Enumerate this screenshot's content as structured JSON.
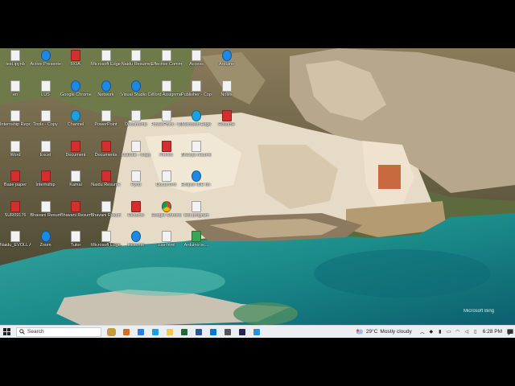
{
  "desktop": {
    "icons": [
      {
        "label": "test.ipynb",
        "glyph": "doc"
      },
      {
        "label": "en",
        "glyph": "doc"
      },
      {
        "label": "Internship Report",
        "glyph": "doc"
      },
      {
        "label": "Word",
        "glyph": "doc"
      },
      {
        "label": "Base paper",
        "glyph": "pdf"
      },
      {
        "label": "SUR09176",
        "glyph": "pdf"
      },
      {
        "label": "Naidu_EVOLL Assignment",
        "glyph": "doc"
      },
      {
        "label": "Active Presenter",
        "glyph": "app"
      },
      {
        "label": "LUS",
        "glyph": "doc"
      },
      {
        "label": "Tools - Copy",
        "glyph": "doc"
      },
      {
        "label": "Excel",
        "glyph": "doc"
      },
      {
        "label": "Internship",
        "glyph": "pdf"
      },
      {
        "label": "Bhavani Resume",
        "glyph": "doc"
      },
      {
        "label": "Zoom",
        "glyph": "app"
      },
      {
        "label": "ROA",
        "glyph": "pdf"
      },
      {
        "label": "Google Chrome",
        "glyph": "app"
      },
      {
        "label": "Channel",
        "glyph": "edge"
      },
      {
        "label": "Document",
        "glyph": "pdf"
      },
      {
        "label": "Kamal",
        "glyph": "doc"
      },
      {
        "label": "Bhavani Resume",
        "glyph": "pdf"
      },
      {
        "label": "Tutor",
        "glyph": "doc"
      },
      {
        "label": "Microsoft Edge",
        "glyph": "doc"
      },
      {
        "label": "Network",
        "glyph": "app"
      },
      {
        "label": "PowerPoint",
        "glyph": "doc"
      },
      {
        "label": "Documents",
        "glyph": "pdf"
      },
      {
        "label": "Naidu Resume",
        "glyph": "pdf"
      },
      {
        "label": "Bhavani Resume",
        "glyph": "doc"
      },
      {
        "label": "Microsoft Edge",
        "glyph": "doc"
      },
      {
        "label": "Naidu Resume",
        "glyph": "doc"
      },
      {
        "label": "Visual Studio Code",
        "glyph": "app"
      },
      {
        "label": "Documents",
        "glyph": "doc"
      },
      {
        "label": "Outlook - Copy",
        "glyph": "doc"
      },
      {
        "label": "Fynd",
        "glyph": "doc"
      },
      {
        "label": "Resume",
        "glyph": "pdf"
      },
      {
        "label": "Resume",
        "glyph": "app"
      },
      {
        "label": "Effective Communication",
        "glyph": "doc"
      },
      {
        "label": "Word Assignment",
        "glyph": "doc"
      },
      {
        "label": "PowerPoint - Copy",
        "glyph": "doc"
      },
      {
        "label": "Firefox",
        "glyph": "pdf"
      },
      {
        "label": "Document",
        "glyph": "doc"
      },
      {
        "label": "Google Chrome",
        "glyph": "chrome"
      },
      {
        "label": ".css-html",
        "glyph": "doc"
      },
      {
        "label": "Access",
        "glyph": "doc"
      },
      {
        "label": "Publisher - Copy",
        "glyph": "doc"
      },
      {
        "label": "Microsoft Edge",
        "glyph": "edge"
      },
      {
        "label": "Bhavya resume",
        "glyph": "doc"
      },
      {
        "label": "Eclipse IDE for Java De...",
        "glyph": "app"
      },
      {
        "label": "test program",
        "glyph": "doc"
      },
      {
        "label": "Arduino-sc...",
        "glyph": "green"
      },
      {
        "label": "Arduino",
        "glyph": "app"
      },
      {
        "label": "Notes",
        "glyph": "doc"
      },
      {
        "label": "Resume",
        "glyph": "pdf"
      }
    ],
    "watermark": "Microsoft Bing"
  },
  "taskbar": {
    "search_label": "Search",
    "apps": [
      {
        "name": "search-highlight",
        "color": "#c59a3b"
      },
      {
        "name": "app-edge-dev",
        "color": "#d96b2a"
      },
      {
        "name": "app-chrome",
        "color": "#2f7be0"
      },
      {
        "name": "app-edge",
        "color": "#1ba1e2"
      },
      {
        "name": "app-file-explorer",
        "color": "#f2c94c"
      },
      {
        "name": "app-teams",
        "color": "#1f6b3a"
      },
      {
        "name": "app-store",
        "color": "#2b5797"
      },
      {
        "name": "app-outlook",
        "color": "#0078d4"
      },
      {
        "name": "app-settings",
        "color": "#555555"
      },
      {
        "name": "app-eclipse",
        "color": "#2c2255"
      },
      {
        "name": "app-vscode",
        "color": "#2d8fd5"
      }
    ],
    "weather_temp": "29°C",
    "weather_desc": "Mostly cloudy",
    "clock": "6:28 PM"
  },
  "colors": {
    "taskbar_bg": "#eceff2",
    "accent": "#0078d4"
  }
}
